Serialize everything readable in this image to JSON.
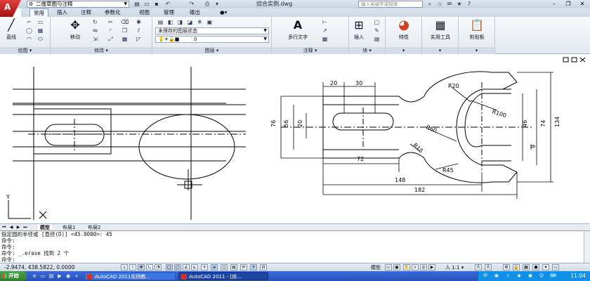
{
  "titlebar": {
    "workspace": "二维草图与注释",
    "document_title": "综合实例.dwg",
    "search_placeholder": "键入关键字或短语"
  },
  "tabs": [
    "常用",
    "插入",
    "注释",
    "参数化",
    "视图",
    "管理",
    "输出"
  ],
  "ribbon": {
    "draw": {
      "line_label": "直线",
      "title": "绘图"
    },
    "modify": {
      "move_label": "移动",
      "title": "修改"
    },
    "layers": {
      "layer_state": "未保存的图层状态",
      "current_layer": "0",
      "title": "图层"
    },
    "annotation": {
      "mtext_label": "多行文字",
      "title": "注释"
    },
    "block": {
      "insert_label": "插入",
      "title": "块"
    },
    "properties": {
      "label": "特性"
    },
    "utilities": {
      "label": "实用工具"
    },
    "clipboard": {
      "label": "剪贴板"
    }
  },
  "drawing": {
    "dims": {
      "d20": "20",
      "d30": "30",
      "d76": "76",
      "d56": "56",
      "d20b": "20",
      "d72": "72",
      "d148": "148",
      "d182": "182",
      "d134": "134",
      "d74": "74",
      "d46": "46",
      "d9": "9",
      "r20": "R20",
      "r100": "R100",
      "r60": "R60",
      "r45": "R45",
      "r15": "R15"
    },
    "ucs": {
      "x": "X",
      "y": "Y"
    }
  },
  "layout_tabs": [
    "模型",
    "布局1",
    "布局2"
  ],
  "command": {
    "lines": [
      "指定圆的半径或 [直径(D)] <45.0000>: 45",
      "命令:",
      "命令:",
      "命令: _.erase 找到 2 个",
      "命令:"
    ]
  },
  "status": {
    "coords": "-2.9474,  438.5822, 0.0000",
    "model": "模型",
    "scale": "1:1"
  },
  "taskbar": {
    "start": "开始",
    "tasks": [
      "AutoCAD 2011实例教...",
      "AutoCAD 2011 - [综..."
    ],
    "clock": "11:04"
  }
}
